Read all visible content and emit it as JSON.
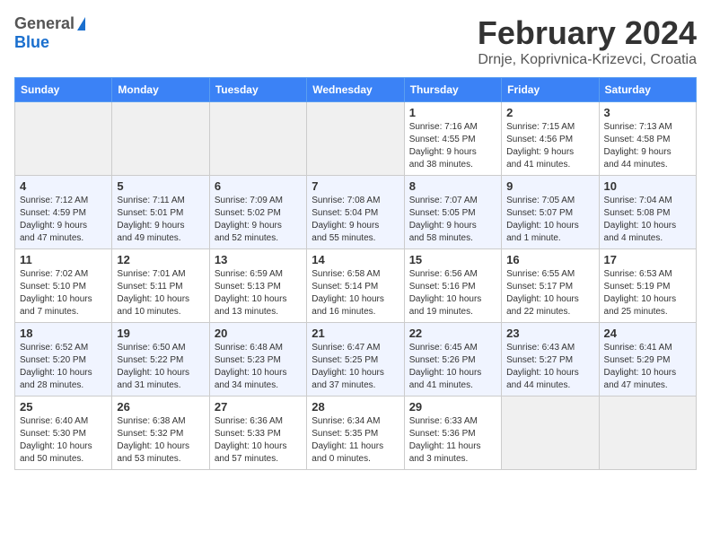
{
  "header": {
    "logo_general": "General",
    "logo_blue": "Blue",
    "month_year": "February 2024",
    "location": "Drnje, Koprivnica-Krizevci, Croatia"
  },
  "weekdays": [
    "Sunday",
    "Monday",
    "Tuesday",
    "Wednesday",
    "Thursday",
    "Friday",
    "Saturday"
  ],
  "rows": [
    [
      {
        "day": "",
        "info": ""
      },
      {
        "day": "",
        "info": ""
      },
      {
        "day": "",
        "info": ""
      },
      {
        "day": "",
        "info": ""
      },
      {
        "day": "1",
        "info": "Sunrise: 7:16 AM\nSunset: 4:55 PM\nDaylight: 9 hours\nand 38 minutes."
      },
      {
        "day": "2",
        "info": "Sunrise: 7:15 AM\nSunset: 4:56 PM\nDaylight: 9 hours\nand 41 minutes."
      },
      {
        "day": "3",
        "info": "Sunrise: 7:13 AM\nSunset: 4:58 PM\nDaylight: 9 hours\nand 44 minutes."
      }
    ],
    [
      {
        "day": "4",
        "info": "Sunrise: 7:12 AM\nSunset: 4:59 PM\nDaylight: 9 hours\nand 47 minutes."
      },
      {
        "day": "5",
        "info": "Sunrise: 7:11 AM\nSunset: 5:01 PM\nDaylight: 9 hours\nand 49 minutes."
      },
      {
        "day": "6",
        "info": "Sunrise: 7:09 AM\nSunset: 5:02 PM\nDaylight: 9 hours\nand 52 minutes."
      },
      {
        "day": "7",
        "info": "Sunrise: 7:08 AM\nSunset: 5:04 PM\nDaylight: 9 hours\nand 55 minutes."
      },
      {
        "day": "8",
        "info": "Sunrise: 7:07 AM\nSunset: 5:05 PM\nDaylight: 9 hours\nand 58 minutes."
      },
      {
        "day": "9",
        "info": "Sunrise: 7:05 AM\nSunset: 5:07 PM\nDaylight: 10 hours\nand 1 minute."
      },
      {
        "day": "10",
        "info": "Sunrise: 7:04 AM\nSunset: 5:08 PM\nDaylight: 10 hours\nand 4 minutes."
      }
    ],
    [
      {
        "day": "11",
        "info": "Sunrise: 7:02 AM\nSunset: 5:10 PM\nDaylight: 10 hours\nand 7 minutes."
      },
      {
        "day": "12",
        "info": "Sunrise: 7:01 AM\nSunset: 5:11 PM\nDaylight: 10 hours\nand 10 minutes."
      },
      {
        "day": "13",
        "info": "Sunrise: 6:59 AM\nSunset: 5:13 PM\nDaylight: 10 hours\nand 13 minutes."
      },
      {
        "day": "14",
        "info": "Sunrise: 6:58 AM\nSunset: 5:14 PM\nDaylight: 10 hours\nand 16 minutes."
      },
      {
        "day": "15",
        "info": "Sunrise: 6:56 AM\nSunset: 5:16 PM\nDaylight: 10 hours\nand 19 minutes."
      },
      {
        "day": "16",
        "info": "Sunrise: 6:55 AM\nSunset: 5:17 PM\nDaylight: 10 hours\nand 22 minutes."
      },
      {
        "day": "17",
        "info": "Sunrise: 6:53 AM\nSunset: 5:19 PM\nDaylight: 10 hours\nand 25 minutes."
      }
    ],
    [
      {
        "day": "18",
        "info": "Sunrise: 6:52 AM\nSunset: 5:20 PM\nDaylight: 10 hours\nand 28 minutes."
      },
      {
        "day": "19",
        "info": "Sunrise: 6:50 AM\nSunset: 5:22 PM\nDaylight: 10 hours\nand 31 minutes."
      },
      {
        "day": "20",
        "info": "Sunrise: 6:48 AM\nSunset: 5:23 PM\nDaylight: 10 hours\nand 34 minutes."
      },
      {
        "day": "21",
        "info": "Sunrise: 6:47 AM\nSunset: 5:25 PM\nDaylight: 10 hours\nand 37 minutes."
      },
      {
        "day": "22",
        "info": "Sunrise: 6:45 AM\nSunset: 5:26 PM\nDaylight: 10 hours\nand 41 minutes."
      },
      {
        "day": "23",
        "info": "Sunrise: 6:43 AM\nSunset: 5:27 PM\nDaylight: 10 hours\nand 44 minutes."
      },
      {
        "day": "24",
        "info": "Sunrise: 6:41 AM\nSunset: 5:29 PM\nDaylight: 10 hours\nand 47 minutes."
      }
    ],
    [
      {
        "day": "25",
        "info": "Sunrise: 6:40 AM\nSunset: 5:30 PM\nDaylight: 10 hours\nand 50 minutes."
      },
      {
        "day": "26",
        "info": "Sunrise: 6:38 AM\nSunset: 5:32 PM\nDaylight: 10 hours\nand 53 minutes."
      },
      {
        "day": "27",
        "info": "Sunrise: 6:36 AM\nSunset: 5:33 PM\nDaylight: 10 hours\nand 57 minutes."
      },
      {
        "day": "28",
        "info": "Sunrise: 6:34 AM\nSunset: 5:35 PM\nDaylight: 11 hours\nand 0 minutes."
      },
      {
        "day": "29",
        "info": "Sunrise: 6:33 AM\nSunset: 5:36 PM\nDaylight: 11 hours\nand 3 minutes."
      },
      {
        "day": "",
        "info": ""
      },
      {
        "day": "",
        "info": ""
      }
    ]
  ]
}
